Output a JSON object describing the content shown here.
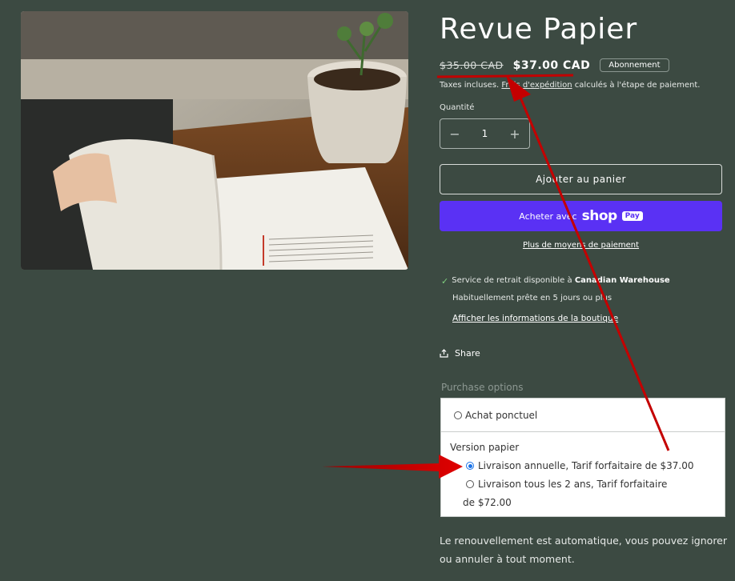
{
  "product": {
    "title": "Revue Papier",
    "old_price": "$35.00 CAD",
    "price": "$37.00 CAD",
    "badge": "Abonnement"
  },
  "tax": {
    "prefix": "Taxes incluses. ",
    "link": "Frais d'expédition",
    "suffix": " calculés à l'étape de paiement."
  },
  "quantity": {
    "label": "Quantité",
    "value": "1",
    "minus": "−",
    "plus": "+"
  },
  "buttons": {
    "add_to_cart": "Ajouter au panier",
    "buy_with": "Acheter avec",
    "shop_logo": "shop",
    "pay_pill": "Pay",
    "more_payment": "Plus de moyens de paiement"
  },
  "pickup": {
    "prefix": "Service de retrait disponible à ",
    "location": "Canadian Warehouse",
    "ready": "Habituellement prête en 5 jours ou plus",
    "store_link": "Afficher les informations de la boutique"
  },
  "share": {
    "label": "Share"
  },
  "purchase_options": {
    "label": "Purchase options",
    "one_time": "Achat ponctuel",
    "group_title": "Version papier",
    "option_annual": "Livraison annuelle, Tarif forfaitaire de $37.00",
    "option_biennial_line1": "Livraison tous les 2 ans, Tarif forfaitaire",
    "option_biennial_line2": "de $72.00",
    "selected": "option_annual"
  },
  "renewal": {
    "line1": "Le renouvellement est automatique, vous pouvez ignorer",
    "line2": "ou annuler à tout moment."
  },
  "icons": {
    "check": "check-icon",
    "share": "share-icon"
  },
  "colors": {
    "background": "#3c4a42",
    "shop_pay": "#5a31f4",
    "annotation": "#d10000"
  }
}
